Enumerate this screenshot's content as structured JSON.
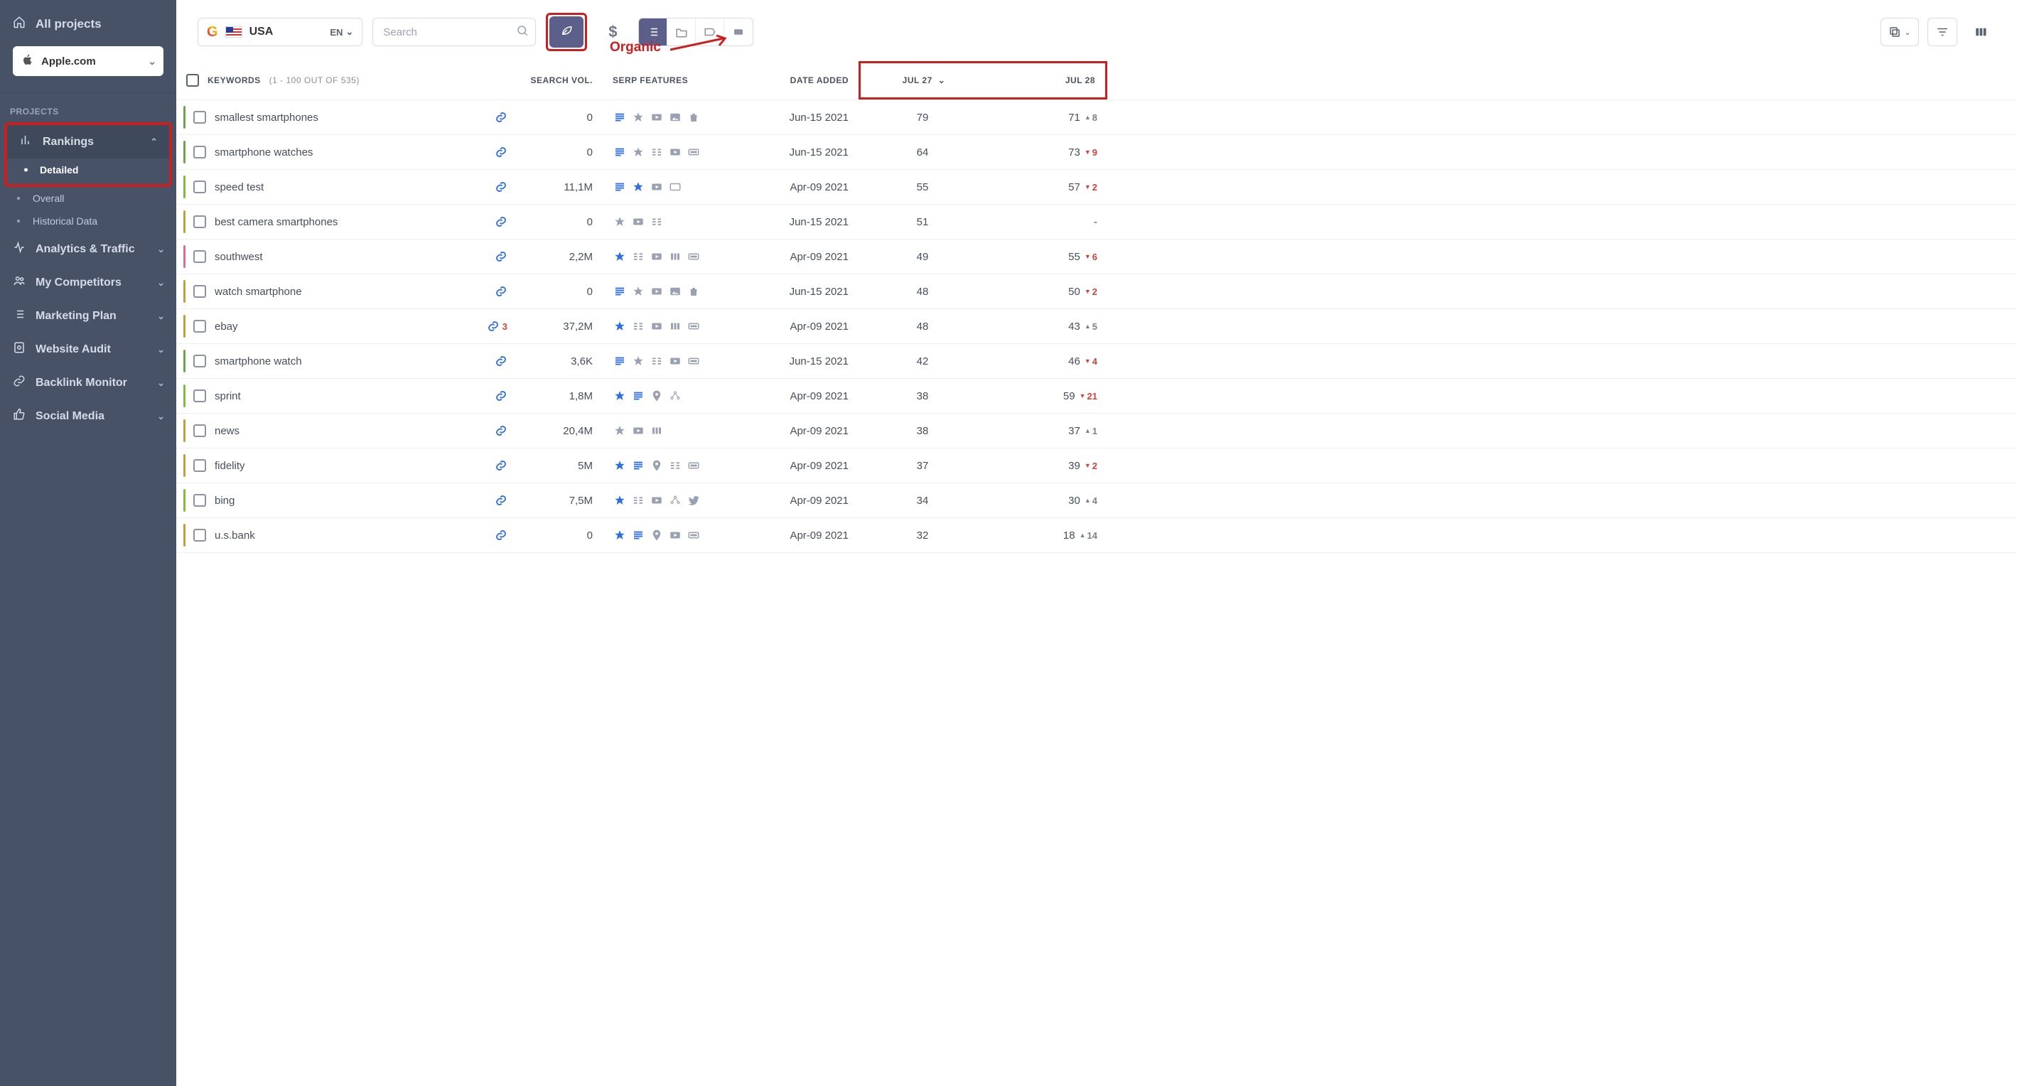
{
  "sidebar": {
    "all_projects": "All projects",
    "project": "Apple.com",
    "section_label": "PROJECTS",
    "rankings": "Rankings",
    "sub": {
      "detailed": "Detailed",
      "overall": "Overall",
      "historical": "Historical Data"
    },
    "items": {
      "analytics": "Analytics & Traffic",
      "competitors": "My Competitors",
      "marketing": "Marketing Plan",
      "audit": "Website Audit",
      "backlink": "Backlink Monitor",
      "social": "Social Media"
    }
  },
  "toolbar": {
    "region": "USA",
    "lang": "EN",
    "search_placeholder": "Search",
    "annotation": "Organic"
  },
  "table": {
    "header": {
      "keywords_label": "KEYWORDS",
      "keywords_count": "(1 - 100 OUT OF 535)",
      "vol": "SEARCH VOL.",
      "serp": "SERP FEATURES",
      "date": "DATE ADDED",
      "jul27": "JUL 27",
      "jul28": "JUL 28"
    },
    "rows": [
      {
        "stripe": "#6aa84f",
        "kw": "smallest smartphones",
        "vol": "0",
        "serp": [
          "lines-b",
          "star",
          "video",
          "image",
          "bag"
        ],
        "date": "Jun-15 2021",
        "j27": "79",
        "j28": "71",
        "d": "8",
        "dir": "up"
      },
      {
        "stripe": "#6aa84f",
        "kw": "smartphone watches",
        "vol": "0",
        "serp": [
          "lines-b",
          "star",
          "dashes",
          "video",
          "more"
        ],
        "date": "Jun-15 2021",
        "j27": "64",
        "j28": "73",
        "d": "9",
        "dir": "down"
      },
      {
        "stripe": "#7dbf3b",
        "kw": "speed test",
        "vol": "11,1M",
        "serp": [
          "lines-b",
          "star-b",
          "video",
          "card"
        ],
        "date": "Apr-09 2021",
        "j27": "55",
        "j28": "57",
        "d": "2",
        "dir": "down"
      },
      {
        "stripe": "#c2a13b",
        "kw": "best camera smartphones",
        "vol": "0",
        "serp": [
          "star",
          "video",
          "dashes"
        ],
        "date": "Jun-15 2021",
        "j27": "51",
        "j28": "-",
        "d": "",
        "dir": ""
      },
      {
        "stripe": "#d96aa8",
        "kw": "southwest",
        "vol": "2,2M",
        "serp": [
          "star-b",
          "dashes",
          "video",
          "bars",
          "more"
        ],
        "date": "Apr-09 2021",
        "j27": "49",
        "j28": "55",
        "d": "6",
        "dir": "down"
      },
      {
        "stripe": "#c2a13b",
        "kw": "watch smartphone",
        "vol": "0",
        "serp": [
          "lines-b",
          "star",
          "video",
          "image",
          "bag"
        ],
        "date": "Jun-15 2021",
        "j27": "48",
        "j28": "50",
        "d": "2",
        "dir": "down"
      },
      {
        "stripe": "#c2a13b",
        "kw": "ebay",
        "link_count": "3",
        "vol": "37,2M",
        "serp": [
          "star-b",
          "dashes",
          "video",
          "bars",
          "more"
        ],
        "date": "Apr-09 2021",
        "j27": "48",
        "j28": "43",
        "d": "5",
        "dir": "up"
      },
      {
        "stripe": "#6aa84f",
        "kw": "smartphone watch",
        "vol": "3,6K",
        "serp": [
          "lines-b",
          "star",
          "dashes",
          "video",
          "more"
        ],
        "date": "Jun-15 2021",
        "j27": "42",
        "j28": "46",
        "d": "4",
        "dir": "down"
      },
      {
        "stripe": "#7dbf3b",
        "kw": "sprint",
        "vol": "1,8M",
        "serp": [
          "star-b",
          "lines-b",
          "pin",
          "dots"
        ],
        "date": "Apr-09 2021",
        "j27": "38",
        "j28": "59",
        "d": "21",
        "dir": "down"
      },
      {
        "stripe": "#c2a13b",
        "kw": "news",
        "vol": "20,4M",
        "serp": [
          "star",
          "video",
          "bars"
        ],
        "date": "Apr-09 2021",
        "j27": "38",
        "j28": "37",
        "d": "1",
        "dir": "up"
      },
      {
        "stripe": "#c2a13b",
        "kw": "fidelity",
        "vol": "5M",
        "serp": [
          "star-b",
          "lines-b",
          "pin",
          "dashes",
          "more"
        ],
        "date": "Apr-09 2021",
        "j27": "37",
        "j28": "39",
        "d": "2",
        "dir": "down"
      },
      {
        "stripe": "#7dbf3b",
        "kw": "bing",
        "vol": "7,5M",
        "serp": [
          "star-b",
          "dashes",
          "video",
          "dots",
          "twitter"
        ],
        "date": "Apr-09 2021",
        "j27": "34",
        "j28": "30",
        "d": "4",
        "dir": "up"
      },
      {
        "stripe": "#c2a13b",
        "kw": "u.s.bank",
        "vol": "0",
        "serp": [
          "star-b",
          "lines-b",
          "pin",
          "video",
          "more"
        ],
        "date": "Apr-09 2021",
        "j27": "32",
        "j28": "18",
        "d": "14",
        "dir": "up"
      }
    ]
  }
}
